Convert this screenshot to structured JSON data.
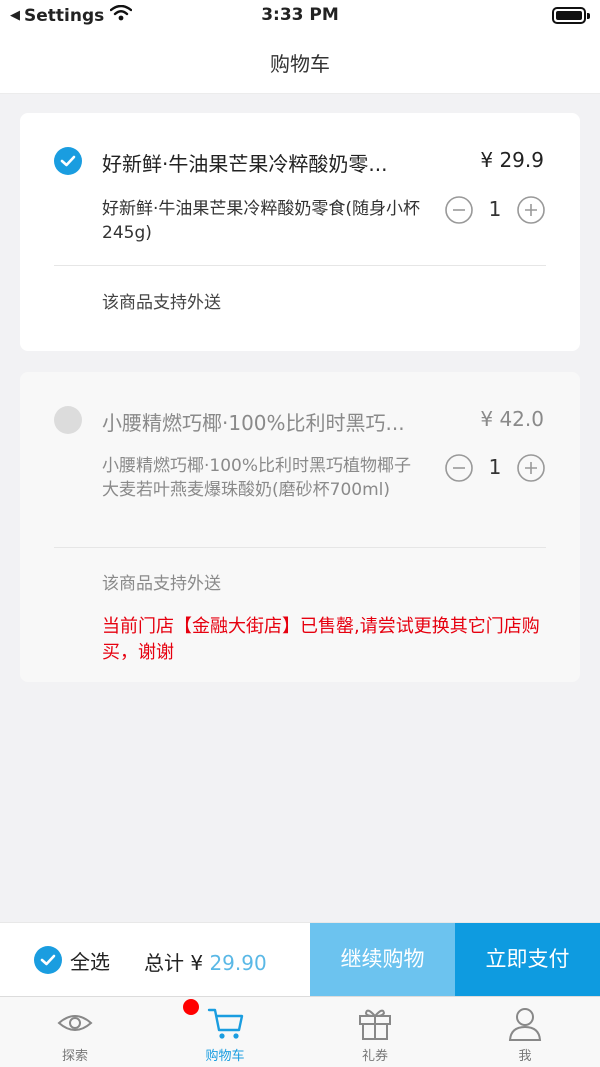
{
  "status_bar": {
    "back_app": "Settings",
    "time": "3:33 PM"
  },
  "nav": {
    "title": "购物车"
  },
  "items": [
    {
      "selected": true,
      "title": "好新鲜·牛油果芒果冷粹酸奶零...",
      "price": "¥ 29.9",
      "description": "好新鲜·牛油果芒果冷粹酸奶零食(随身小杯 245g)",
      "quantity": "1",
      "delivery": "该商品支持外送"
    },
    {
      "selected": false,
      "title": "小腰精燃巧椰·100%比利时黑巧...",
      "price": "¥ 42.0",
      "description": "小腰精燃巧椰·100%比利时黑巧植物椰子大麦若叶燕麦爆珠酸奶(磨砂杯700ml)",
      "quantity": "1",
      "delivery": "该商品支持外送",
      "notice": "当前门店【金融大街店】已售罄,请尝试更换其它门店购买，谢谢"
    }
  ],
  "footer": {
    "select_all_label": "全选",
    "total_label": "总计 ¥ ",
    "total_amount": "29.90",
    "continue_label": "继续购物",
    "pay_label": "立即支付"
  },
  "tabs": [
    {
      "label": "探索",
      "icon": "eye-icon"
    },
    {
      "label": "购物车",
      "icon": "cart-icon",
      "active": true,
      "badge": true
    },
    {
      "label": "礼券",
      "icon": "gift-icon"
    },
    {
      "label": "我",
      "icon": "person-icon"
    }
  ],
  "colors": {
    "accent": "#1a9de0",
    "accent_light": "#6cc3ef",
    "alert": "#e6000f",
    "badge": "#ff0000"
  }
}
